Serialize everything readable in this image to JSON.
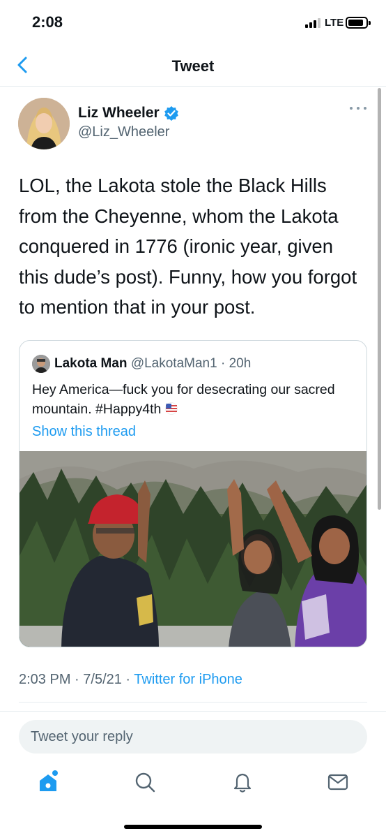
{
  "status_bar": {
    "time": "2:08",
    "network": "LTE"
  },
  "nav": {
    "title": "Tweet",
    "back_icon": "chevron-left-icon"
  },
  "tweet": {
    "author_name": "Liz Wheeler",
    "author_handle": "@Liz_Wheeler",
    "verified": true,
    "text": "LOL, the Lakota stole the Black Hills from the Cheyenne, whom the Lakota conquered in 1776 (ironic year, given this dude’s post). Funny, how you forgot to mention that in your post.",
    "time": "2:03 PM",
    "date": "7/5/21",
    "client": "Twitter for iPhone"
  },
  "quoted_tweet": {
    "author_name": "Lakota Man",
    "author_handle": "@LakotaMan1",
    "age": "20h",
    "text": "Hey America—fuck you for desecrating our sacred mountain. #Happy4th",
    "show_thread": "Show this thread"
  },
  "reply": {
    "placeholder": "Tweet your reply"
  },
  "tabs": [
    "home-icon",
    "search-icon",
    "notifications-icon",
    "messages-icon"
  ],
  "colors": {
    "accent": "#1d9bf0",
    "secondary_text": "#536471",
    "divider": "#e6ecf0"
  }
}
